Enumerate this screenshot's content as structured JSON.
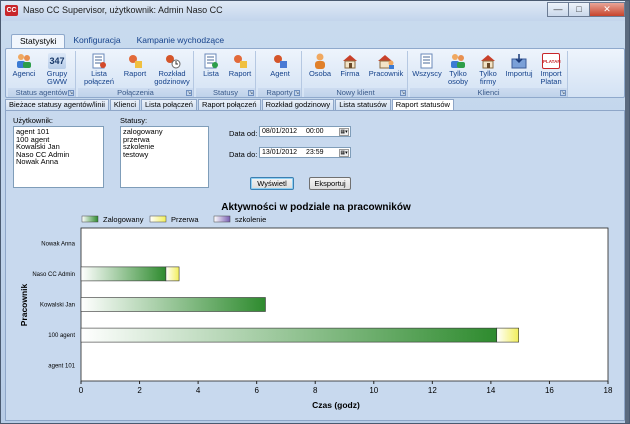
{
  "window": {
    "app_icon": "CC",
    "title": "Naso CC Supervisor, użytkownik: Admin Naso CC",
    "controls": {
      "minimize": "—",
      "maximize": "□",
      "close": "✕"
    }
  },
  "ribbon_tabs": [
    "Statystyki",
    "Konfiguracja",
    "Kampanie wychodzące"
  ],
  "ribbon_groups": [
    {
      "label": "Status agentów",
      "buttons": [
        {
          "label": "Agenci",
          "icon": "people-icon"
        },
        {
          "label": "Grupy GWW",
          "icon": "counter-347-icon",
          "icon_text": "347"
        }
      ]
    },
    {
      "label": "Połączenia",
      "buttons": [
        {
          "label": "Lista połączeń",
          "icon": "list-icon"
        },
        {
          "label": "Raport",
          "icon": "report-icon"
        },
        {
          "label": "Rozkład godzinowy",
          "icon": "hourly-report-icon"
        }
      ]
    },
    {
      "label": "Statusy",
      "buttons": [
        {
          "label": "Lista",
          "icon": "list-icon"
        },
        {
          "label": "Raport",
          "icon": "report-icon"
        }
      ]
    },
    {
      "label": "Raporty",
      "buttons": [
        {
          "label": "Agent",
          "icon": "agent-report-icon"
        }
      ]
    },
    {
      "label": "Nowy klient",
      "buttons": [
        {
          "label": "Osoba",
          "icon": "person-icon"
        },
        {
          "label": "Firma",
          "icon": "house-icon"
        },
        {
          "label": "Pracownik",
          "icon": "house-person-icon"
        }
      ]
    },
    {
      "label": "Klienci",
      "buttons": [
        {
          "label": "Wszyscy",
          "icon": "list-icon"
        },
        {
          "label": "Tylko osoby",
          "icon": "people-icon"
        },
        {
          "label": "Tylko firmy",
          "icon": "house-icon"
        },
        {
          "label": "Importuj",
          "icon": "import-icon"
        },
        {
          "label": "Import Platan",
          "icon": "platan-icon",
          "icon_text": "PLATAN"
        }
      ]
    }
  ],
  "doc_tabs": [
    "Bieżace statusy agentów/linii",
    "Klienci",
    "Lista połączeń",
    "Raport połączeń",
    "Rozkład godzinowy",
    "Lista statusów",
    "Raport statusów"
  ],
  "filters": {
    "users_label": "Użytkownik:",
    "users": [
      "agent 101",
      "100 agent",
      "Kowalski Jan",
      "Naso CC Admin",
      "Nowak Anna"
    ],
    "statuses_label": "Statusy:",
    "statuses": [
      "zalogowany",
      "przerwa",
      "szkolenie",
      "testowy"
    ],
    "date_from_label": "Data od:",
    "date_from": "08/01/2012",
    "time_from": "00:00",
    "date_to_label": "Data do:",
    "date_to": "13/01/2012",
    "time_to": "23:59",
    "calendar_icon": "▦▾",
    "show_button": "Wyświetl",
    "export_button": "Eksportuj"
  },
  "chart_data": {
    "type": "bar",
    "orientation": "horizontal",
    "stacked": true,
    "title": "Aktywności w podziale na pracowników",
    "xlabel": "Czas (godz)",
    "ylabel": "Pracownik",
    "xlim": [
      0,
      18
    ],
    "xticks": [
      0,
      2,
      4,
      6,
      8,
      10,
      12,
      14,
      16,
      18
    ],
    "categories": [
      "Nowak Anna",
      "Naso CC Admin",
      "Kowalski Jan",
      "100 agent",
      "agent 101"
    ],
    "series": [
      {
        "name": "Zalogowany",
        "color": "#2e8b2e",
        "values": [
          0,
          2.9,
          6.3,
          14.2,
          0
        ]
      },
      {
        "name": "Przerwa",
        "color": "#f2ef5a",
        "values": [
          0,
          0.45,
          0,
          0.75,
          0
        ]
      },
      {
        "name": "szkolenie",
        "color": "#7a5fb4",
        "values": [
          0,
          0,
          0,
          0,
          0
        ]
      }
    ],
    "legend": "top-left",
    "grid": false
  }
}
